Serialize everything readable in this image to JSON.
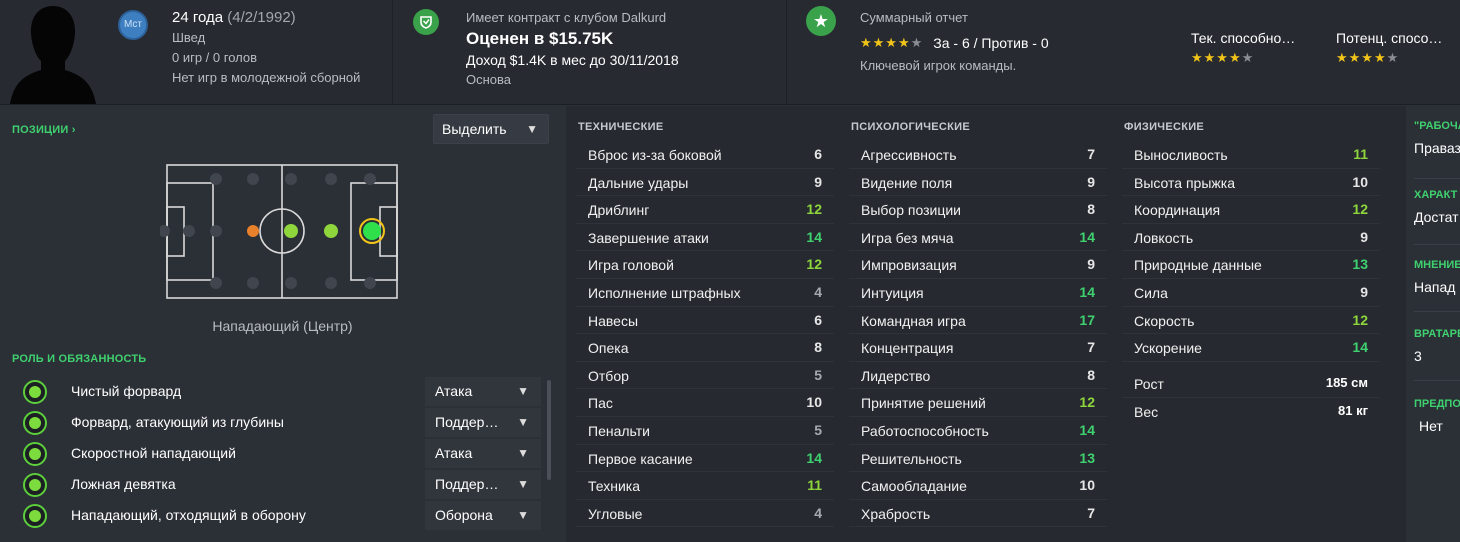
{
  "header": {
    "club_badge": "Мст",
    "age": "24 года",
    "dob": "(4/2/1992)",
    "nationality": "Швед",
    "games": "0 игр / 0 голов",
    "youth": "Нет игр в молодежной сборной",
    "contract_club": "Имеет контракт с клубом Dalkurd",
    "value": "Оценен в $15.75K",
    "income": "Доход $1.4K в мес до 30/11/2018",
    "squad_status": "Основа",
    "report_title": "Суммарный отчет",
    "report_stars": 4,
    "report_for_against": "За - 6 / Против - 0",
    "report_note": "Ключевой игрок команды.",
    "current_ability_label": "Тек. способно…",
    "current_ability_stars": 4,
    "potential_ability_label": "Потенц. спосо…",
    "potential_ability_stars": 4,
    "accent_color": "#3fd16f"
  },
  "left": {
    "positions_title": "ПОЗИЦИИ ›",
    "highlight_label": "Выделить",
    "position_label": "Нападающий (Центр)",
    "roles_title": "РОЛЬ И ОБЯЗАННОСТЬ",
    "roles": [
      {
        "name": "Чистый форвард",
        "duty": "Атака"
      },
      {
        "name": "Форвард, атакующий из глубины",
        "duty": "Поддер…"
      },
      {
        "name": "Скоростной нападающий",
        "duty": "Атака"
      },
      {
        "name": "Ложная девятка",
        "duty": "Поддер…"
      },
      {
        "name": "Нападающий, отходящий в оборону",
        "duty": "Оборона"
      }
    ]
  },
  "attributes": {
    "technical_title": "ТЕХНИЧЕСКИЕ",
    "technical": [
      {
        "name": "Вброс из-за боковой",
        "value": "6"
      },
      {
        "name": "Дальние удары",
        "value": "9"
      },
      {
        "name": "Дриблинг",
        "value": "12"
      },
      {
        "name": "Завершение атаки",
        "value": "14"
      },
      {
        "name": "Игра головой",
        "value": "12"
      },
      {
        "name": "Исполнение штрафных",
        "value": "4"
      },
      {
        "name": "Навесы",
        "value": "6"
      },
      {
        "name": "Опека",
        "value": "8"
      },
      {
        "name": "Отбор",
        "value": "5"
      },
      {
        "name": "Пас",
        "value": "10"
      },
      {
        "name": "Пенальти",
        "value": "5"
      },
      {
        "name": "Первое касание",
        "value": "14"
      },
      {
        "name": "Техника",
        "value": "11"
      },
      {
        "name": "Угловые",
        "value": "4"
      }
    ],
    "mental_title": "ПСИХОЛОГИЧЕСКИЕ",
    "mental": [
      {
        "name": "Агрессивность",
        "value": "7"
      },
      {
        "name": "Видение поля",
        "value": "9"
      },
      {
        "name": "Выбор позиции",
        "value": "8"
      },
      {
        "name": "Игра без мяча",
        "value": "14"
      },
      {
        "name": "Импровизация",
        "value": "9"
      },
      {
        "name": "Интуиция",
        "value": "14"
      },
      {
        "name": "Командная игра",
        "value": "17"
      },
      {
        "name": "Концентрация",
        "value": "7"
      },
      {
        "name": "Лидерство",
        "value": "8"
      },
      {
        "name": "Принятие решений",
        "value": "12"
      },
      {
        "name": "Работоспособность",
        "value": "14"
      },
      {
        "name": "Решительность",
        "value": "13"
      },
      {
        "name": "Самообладание",
        "value": "10"
      },
      {
        "name": "Храбрость",
        "value": "7"
      }
    ],
    "physical_title": "ФИЗИЧЕСКИЕ",
    "physical": [
      {
        "name": "Выносливость",
        "value": "11"
      },
      {
        "name": "Высота прыжка",
        "value": "10"
      },
      {
        "name": "Координация",
        "value": "12"
      },
      {
        "name": "Ловкость",
        "value": "9"
      },
      {
        "name": "Природные данные",
        "value": "13"
      },
      {
        "name": "Сила",
        "value": "9"
      },
      {
        "name": "Скорость",
        "value": "12"
      },
      {
        "name": "Ускорение",
        "value": "14"
      }
    ],
    "height_label": "Рост",
    "height": "185 см",
    "weight_label": "Вес",
    "weight": "81 кг"
  },
  "right": {
    "items": [
      {
        "title": "\"РАБОЧА",
        "value": "Праваз"
      },
      {
        "title": "ХАРАКТ",
        "value": "Достат"
      },
      {
        "title": "МНЕНИЕ",
        "value": "Напад"
      },
      {
        "title": "ВРАТАРЕ",
        "value": "3"
      },
      {
        "title": "ПРЕДПО",
        "value": "Нет"
      }
    ]
  }
}
